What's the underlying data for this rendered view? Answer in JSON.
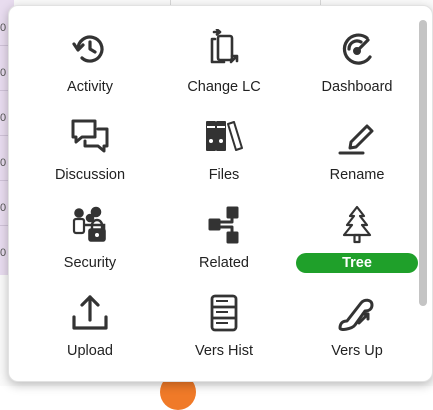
{
  "background": {
    "row_markers": [
      "0",
      "0",
      "0",
      "0",
      "0",
      "0"
    ]
  },
  "menu": {
    "items": [
      {
        "label": "Activity",
        "icon": "history-icon",
        "selected": false
      },
      {
        "label": "Change LC",
        "icon": "change-lifecycle-icon",
        "selected": false
      },
      {
        "label": "Dashboard",
        "icon": "dashboard-gauge-icon",
        "selected": false
      },
      {
        "label": "Discussion",
        "icon": "discussion-bubbles-icon",
        "selected": false
      },
      {
        "label": "Files",
        "icon": "files-binders-icon",
        "selected": false
      },
      {
        "label": "Rename",
        "icon": "rename-pen-icon",
        "selected": false
      },
      {
        "label": "Security",
        "icon": "security-users-lock-icon",
        "selected": false
      },
      {
        "label": "Related",
        "icon": "related-nodes-icon",
        "selected": false
      },
      {
        "label": "Tree",
        "icon": "tree-icon",
        "selected": true
      },
      {
        "label": "Upload",
        "icon": "upload-icon",
        "selected": false
      },
      {
        "label": "Vers Hist",
        "icon": "version-history-server-icon",
        "selected": false
      },
      {
        "label": "Vers Up",
        "icon": "version-up-escalator-icon",
        "selected": false
      }
    ]
  },
  "colors": {
    "selected_pill": "#1fa02a",
    "icon": "#333333",
    "accent_dot": "#f07a28"
  }
}
